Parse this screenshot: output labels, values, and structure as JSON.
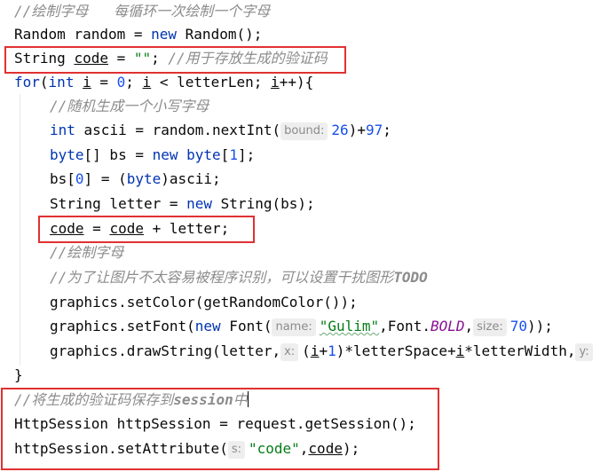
{
  "lines": {
    "l1": {
      "comment": "//绘制字母   每循环一次绘制一个字母"
    },
    "l2": {
      "a": "Random random = ",
      "kw": "new",
      "b": " Random();"
    },
    "l3": {
      "a": "String ",
      "var": "code",
      "b": " = ",
      "str": "\"\"",
      "c": "; ",
      "comment": "//用于存放生成的验证码"
    },
    "l4": {
      "kw_for": "for",
      "p1": "(",
      "kw_int": "int",
      "s1": " ",
      "i1": "i",
      "s2": " = ",
      "n0": "0",
      "s3": "; ",
      "i2": "i",
      "s4": " < letterLen; ",
      "i3": "i",
      "s5": "++){"
    },
    "l5": {
      "comment": "//随机生成一个小写字母"
    },
    "l6": {
      "kw_int": "int",
      "a": " ascii = random.nextInt(",
      "hint": "bound:",
      "n1": "26",
      "b": ")+",
      "n2": "97",
      "c": ";"
    },
    "l7": {
      "kw1": "byte",
      "a": "[] bs = ",
      "kw2": "new",
      "s": " ",
      "kw3": "byte",
      "b": "[",
      "n": "1",
      "c": "];"
    },
    "l8": {
      "a": "bs[",
      "n": "0",
      "b": "] = (",
      "kw": "byte",
      "c": ")ascii;"
    },
    "l9": {
      "a": "String letter = ",
      "kw": "new",
      "b": " String(bs);"
    },
    "l10": {
      "v1": "code",
      "a": " = ",
      "v2": "code",
      "b": " + letter;"
    },
    "l11": {
      "comment": "//绘制字母"
    },
    "l12": {
      "comment": "//为了让图片不太容易被程序识别，可以设置干扰图形",
      "todo": "TODO"
    },
    "l13": {
      "a": "graphics.setColor(getRandomColor());"
    },
    "l14": {
      "a": "graphics.setFont(",
      "kw": "new",
      "b": " Font(",
      "hint1": "name:",
      "str": "\"Gulim\"",
      "c": ",Font.",
      "field": "BOLD",
      "d": ",",
      "hint2": "size:",
      "n": "70",
      "e": "));"
    },
    "l15": {
      "a": "graphics.drawString(letter,",
      "hint": "x:",
      "b": "(",
      "i1": "i",
      "c": "+",
      "n": "1",
      "d": ")*letterSpace+",
      "i2": "i",
      "e": "*letterWidth,",
      "hint2": "y:"
    },
    "l16": {
      "a": "}"
    },
    "l17": {
      "comment": "//将生成的验证码保存到",
      "comment_b": "session",
      "comment_c": "中"
    },
    "l18": {
      "a": "HttpSession httpSession = request.getSession();"
    },
    "l19": {
      "a": "httpSession.setAttribute(",
      "hint": "s:",
      "str": "\"code\"",
      "b": ",",
      "var": "code",
      "c": ");"
    }
  },
  "colors": {
    "keyword": "#0033b3",
    "comment": "#8c8c8c",
    "string": "#067d17",
    "number": "#1750eb",
    "field": "#871094",
    "highlight_box": "#e03131"
  }
}
